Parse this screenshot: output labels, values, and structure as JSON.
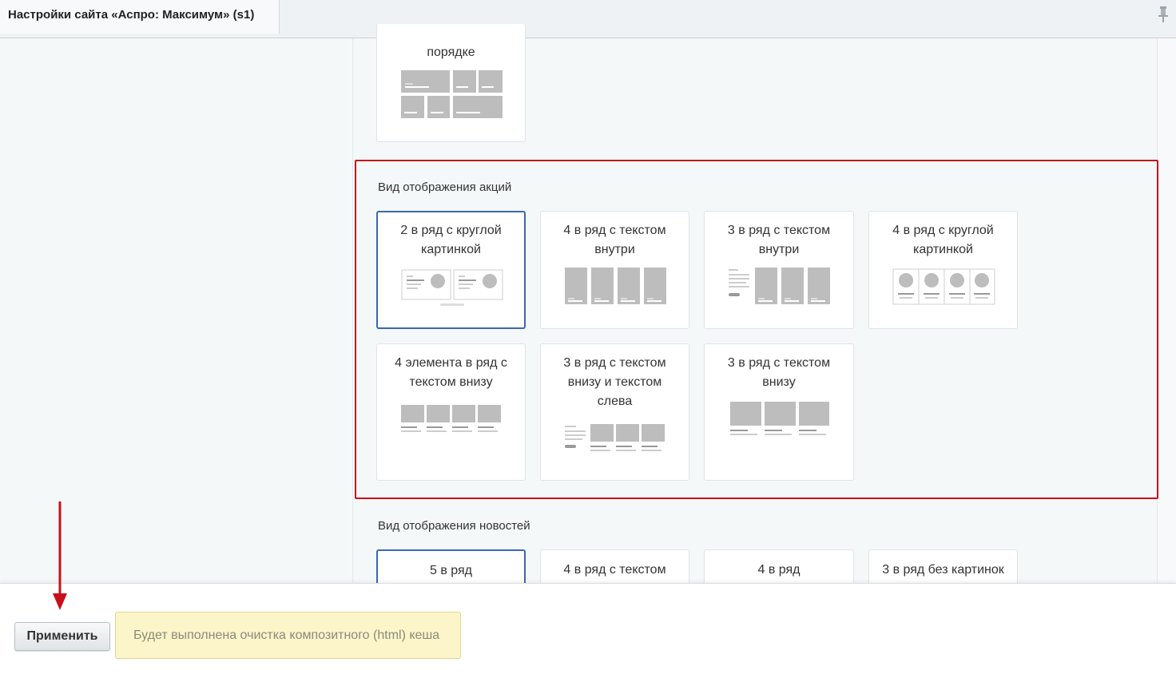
{
  "header": {
    "title": "Настройки сайта «Аспро: Максимум» (s1)"
  },
  "top_card": {
    "label": "порядке"
  },
  "promo_section": {
    "title": "Вид отображения акций",
    "cards": [
      {
        "label": "2 в ряд с круглой картинкой",
        "selected": true
      },
      {
        "label": "4 в ряд с текстом внутри",
        "selected": false
      },
      {
        "label": "3 в ряд с текстом внутри",
        "selected": false
      },
      {
        "label": "4 в ряд с круглой картинкой",
        "selected": false
      },
      {
        "label": "4 элемента в ряд с текстом внизу",
        "selected": false
      },
      {
        "label": "3 в ряд с текстом внизу и текстом слева",
        "selected": false
      },
      {
        "label": "3 в ряд с текстом внизу",
        "selected": false
      }
    ]
  },
  "news_section": {
    "title": "Вид отображения новостей",
    "cards": [
      {
        "label": "5 в ряд",
        "selected": true
      },
      {
        "label": "4 в ряд с текстом",
        "selected": false
      },
      {
        "label": "4 в ряд",
        "selected": false
      },
      {
        "label": "3 в ряд без картинок",
        "selected": false
      }
    ]
  },
  "footer": {
    "apply_label": "Применить",
    "notice": "Будет выполнена очистка композитного (html) кеша"
  },
  "colors": {
    "selected_border": "#3c67b0",
    "highlight_border": "#c8101a",
    "notice_bg": "#fbf5c9",
    "thumb_gray": "#bdbdbd"
  },
  "icons": {
    "pin": "pin-icon",
    "arrow": "arrow-down-icon"
  }
}
